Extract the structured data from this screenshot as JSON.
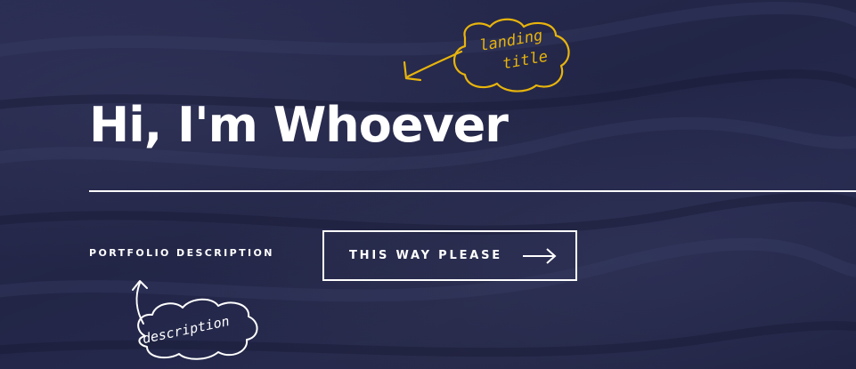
{
  "hero": {
    "title": "Hi, I'm Whoever",
    "description": "PORTFOLIO DESCRIPTION",
    "cta_label": "THIS WAY PLEASE"
  },
  "annotations": {
    "title_note_line1": "landing",
    "title_note_line2": "title",
    "description_note": "description"
  },
  "icons": {
    "cta_icon": "arrow-right-icon"
  },
  "colors": {
    "background": "#24274a",
    "text": "#ffffff",
    "annotation_title": "#e8b40c",
    "annotation_description": "#ffffff"
  }
}
